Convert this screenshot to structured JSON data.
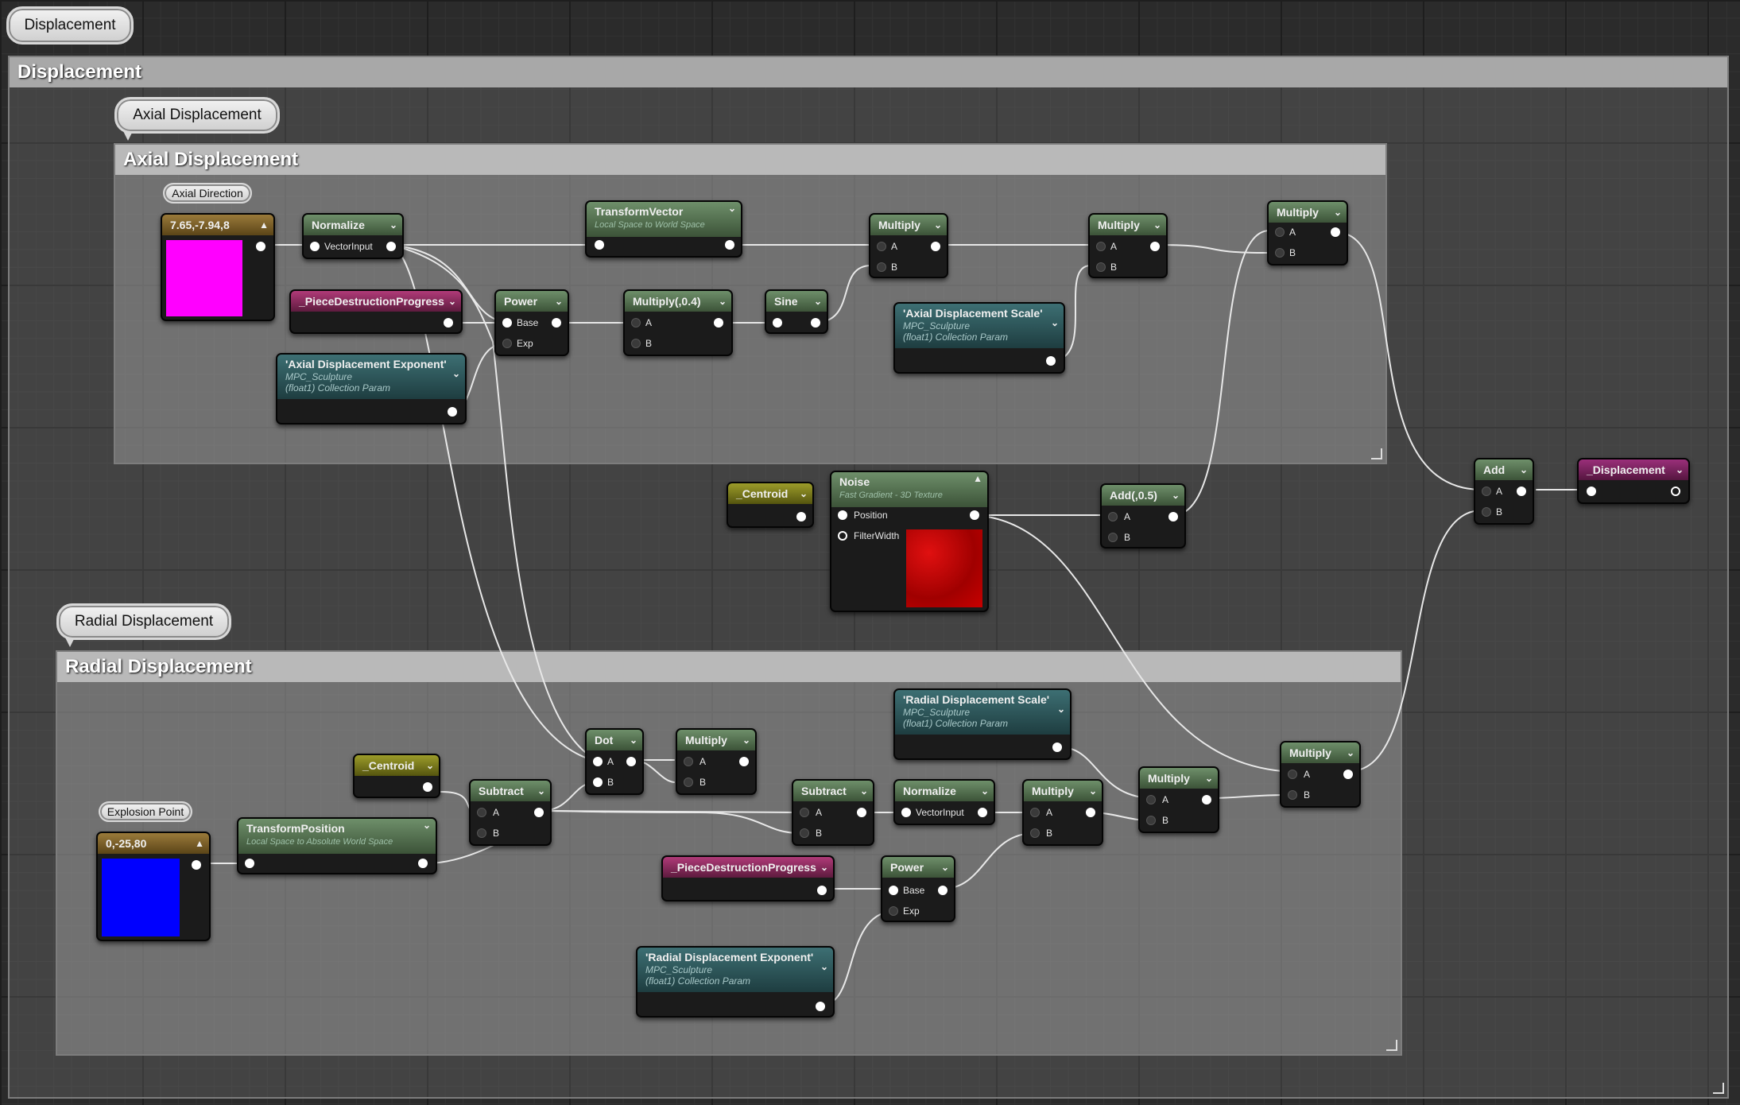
{
  "graph": {
    "outer": {
      "bubble": "Displacement",
      "title": "Displacement"
    },
    "axial": {
      "bubble": "Axial Displacement",
      "title": "Axial Displacement"
    },
    "radial": {
      "bubble": "Radial Displacement",
      "title": "Radial Displacement"
    }
  },
  "colors": {
    "swatch_axial": "#ff00ff",
    "swatch_radial": "#0000ff",
    "noise_preview": "#cc0000"
  },
  "nodes": {
    "axial_dir_bubble": "Axial Direction",
    "axial_const": "7.65,-7.94,8",
    "normalize1": {
      "title": "Normalize",
      "in": "VectorInput"
    },
    "transformvector": {
      "title": "TransformVector",
      "sub": "Local Space to World Space"
    },
    "multiply1": {
      "title": "Multiply",
      "a": "A",
      "b": "B"
    },
    "multiply2": {
      "title": "Multiply",
      "a": "A",
      "b": "B"
    },
    "multiply3": {
      "title": "Multiply",
      "a": "A",
      "b": "B"
    },
    "piece1": "_PieceDestructionProgress",
    "power1": {
      "title": "Power",
      "a": "Base",
      "b": "Exp"
    },
    "multiply04": {
      "title": "Multiply(,0.4)",
      "a": "A",
      "b": "B"
    },
    "sine": "Sine",
    "axial_scale": {
      "title": "'Axial Displacement Scale'",
      "l1": "MPC_Sculpture",
      "l2": "(float1) Collection Param"
    },
    "axial_exp": {
      "title": "'Axial Displacement Exponent'",
      "l1": "MPC_Sculpture",
      "l2": "(float1) Collection Param"
    },
    "centroid1": "_Centroid",
    "noise": {
      "title": "Noise",
      "sub": "Fast Gradient - 3D Texture",
      "a": "Position",
      "b": "FilterWidth"
    },
    "add05": {
      "title": "Add(,0.5)",
      "a": "A",
      "b": "B"
    },
    "add": {
      "title": "Add",
      "a": "A",
      "b": "B"
    },
    "displacement": "_Displacement",
    "radial_scale": {
      "title": "'Radial Displacement Scale'",
      "l1": "MPC_Sculpture",
      "l2": "(float1) Collection Param"
    },
    "centroid2": "_Centroid",
    "explosion_bubble": "Explosion Point",
    "explosion_const": "0,-25,80",
    "transformposition": {
      "title": "TransformPosition",
      "sub": "Local Space to Absolute World Space"
    },
    "subtract1": {
      "title": "Subtract",
      "a": "A",
      "b": "B"
    },
    "dot": {
      "title": "Dot",
      "a": "A",
      "b": "B"
    },
    "multiply4": {
      "title": "Multiply",
      "a": "A",
      "b": "B"
    },
    "subtract2": {
      "title": "Subtract",
      "a": "A",
      "b": "B"
    },
    "normalize2": {
      "title": "Normalize",
      "in": "VectorInput"
    },
    "multiply5": {
      "title": "Multiply",
      "a": "A",
      "b": "B"
    },
    "multiply6": {
      "title": "Multiply",
      "a": "A",
      "b": "B"
    },
    "multiply7": {
      "title": "Multiply",
      "a": "A",
      "b": "B"
    },
    "piece2": "_PieceDestructionProgress",
    "power2": {
      "title": "Power",
      "a": "Base",
      "b": "Exp"
    },
    "radial_exp": {
      "title": "'Radial Displacement Exponent'",
      "l1": "MPC_Sculpture",
      "l2": "(float1) Collection Param"
    }
  }
}
